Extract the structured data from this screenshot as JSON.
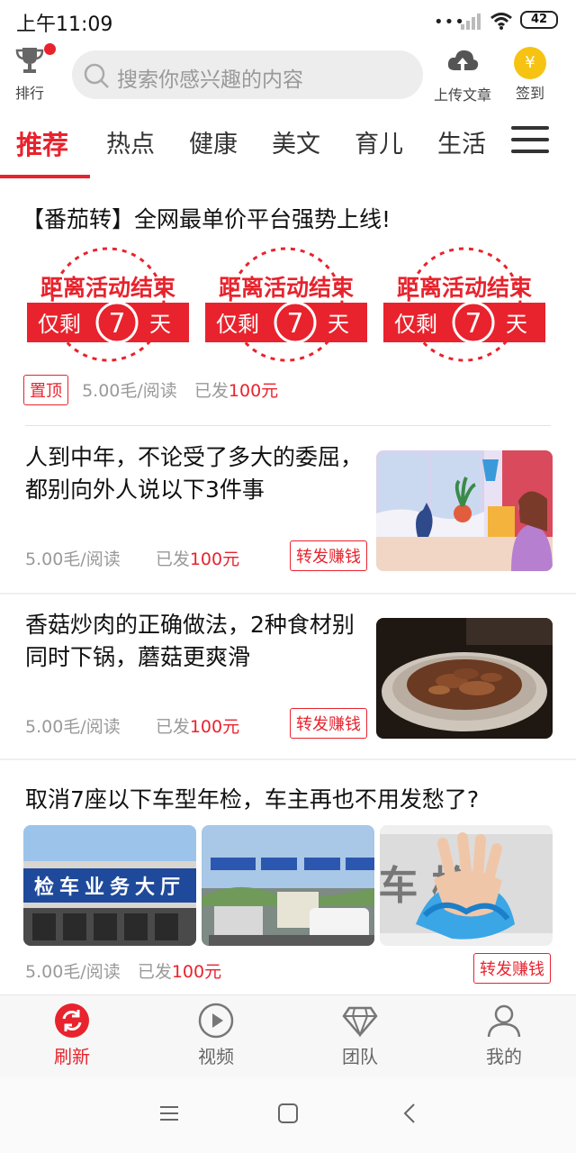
{
  "status": {
    "time": "上午11:09",
    "dots": "•••",
    "battery": "42"
  },
  "header": {
    "rank_label": "排行",
    "search_placeholder": "搜索你感兴趣的内容",
    "upload_label": "上传文章",
    "signin_label": "签到",
    "coin_symbol": "¥"
  },
  "tabs": [
    {
      "label": "推荐",
      "active": true
    },
    {
      "label": "热点"
    },
    {
      "label": "健康"
    },
    {
      "label": "美文"
    },
    {
      "label": "育儿"
    },
    {
      "label": "生活"
    }
  ],
  "promo": {
    "title": "【番茄转】全网最单价平台强势上线!",
    "banner_line1": "距离活动结束",
    "banner_prefix": "仅剩",
    "banner_days": "7",
    "banner_suffix": "天",
    "pin_tag": "置顶",
    "rate": "5.00毛/阅读",
    "paid_prefix": "已发",
    "paid_amount": "100元"
  },
  "articles": [
    {
      "title": "人到中年，不论受了多大的委屈，都别向外人说以下3件事",
      "rate": "5.00毛/阅读",
      "paid_prefix": "已发",
      "paid_amount": "100元",
      "share_label": "转发赚钱"
    },
    {
      "title": "香菇炒肉的正确做法，2种食材别同时下锅，蘑菇更爽滑",
      "rate": "5.00毛/阅读",
      "paid_prefix": "已发",
      "paid_amount": "100元",
      "share_label": "转发赚钱"
    },
    {
      "title": "取消7座以下车型年检，车主再也不用发愁了?",
      "rate": "5.00毛/阅读",
      "paid_prefix": "已发",
      "paid_amount": "100元",
      "share_label": "转发赚钱",
      "img1_text": "检车业务大厅",
      "img3_text": "车 检"
    }
  ],
  "bottom_nav": [
    {
      "label": "刷新",
      "icon": "refresh-icon",
      "active": true
    },
    {
      "label": "视频",
      "icon": "play-icon"
    },
    {
      "label": "团队",
      "icon": "diamond-icon"
    },
    {
      "label": "我的",
      "icon": "user-icon"
    }
  ],
  "colors": {
    "accent": "#e8232d",
    "coin": "#f6c312"
  }
}
